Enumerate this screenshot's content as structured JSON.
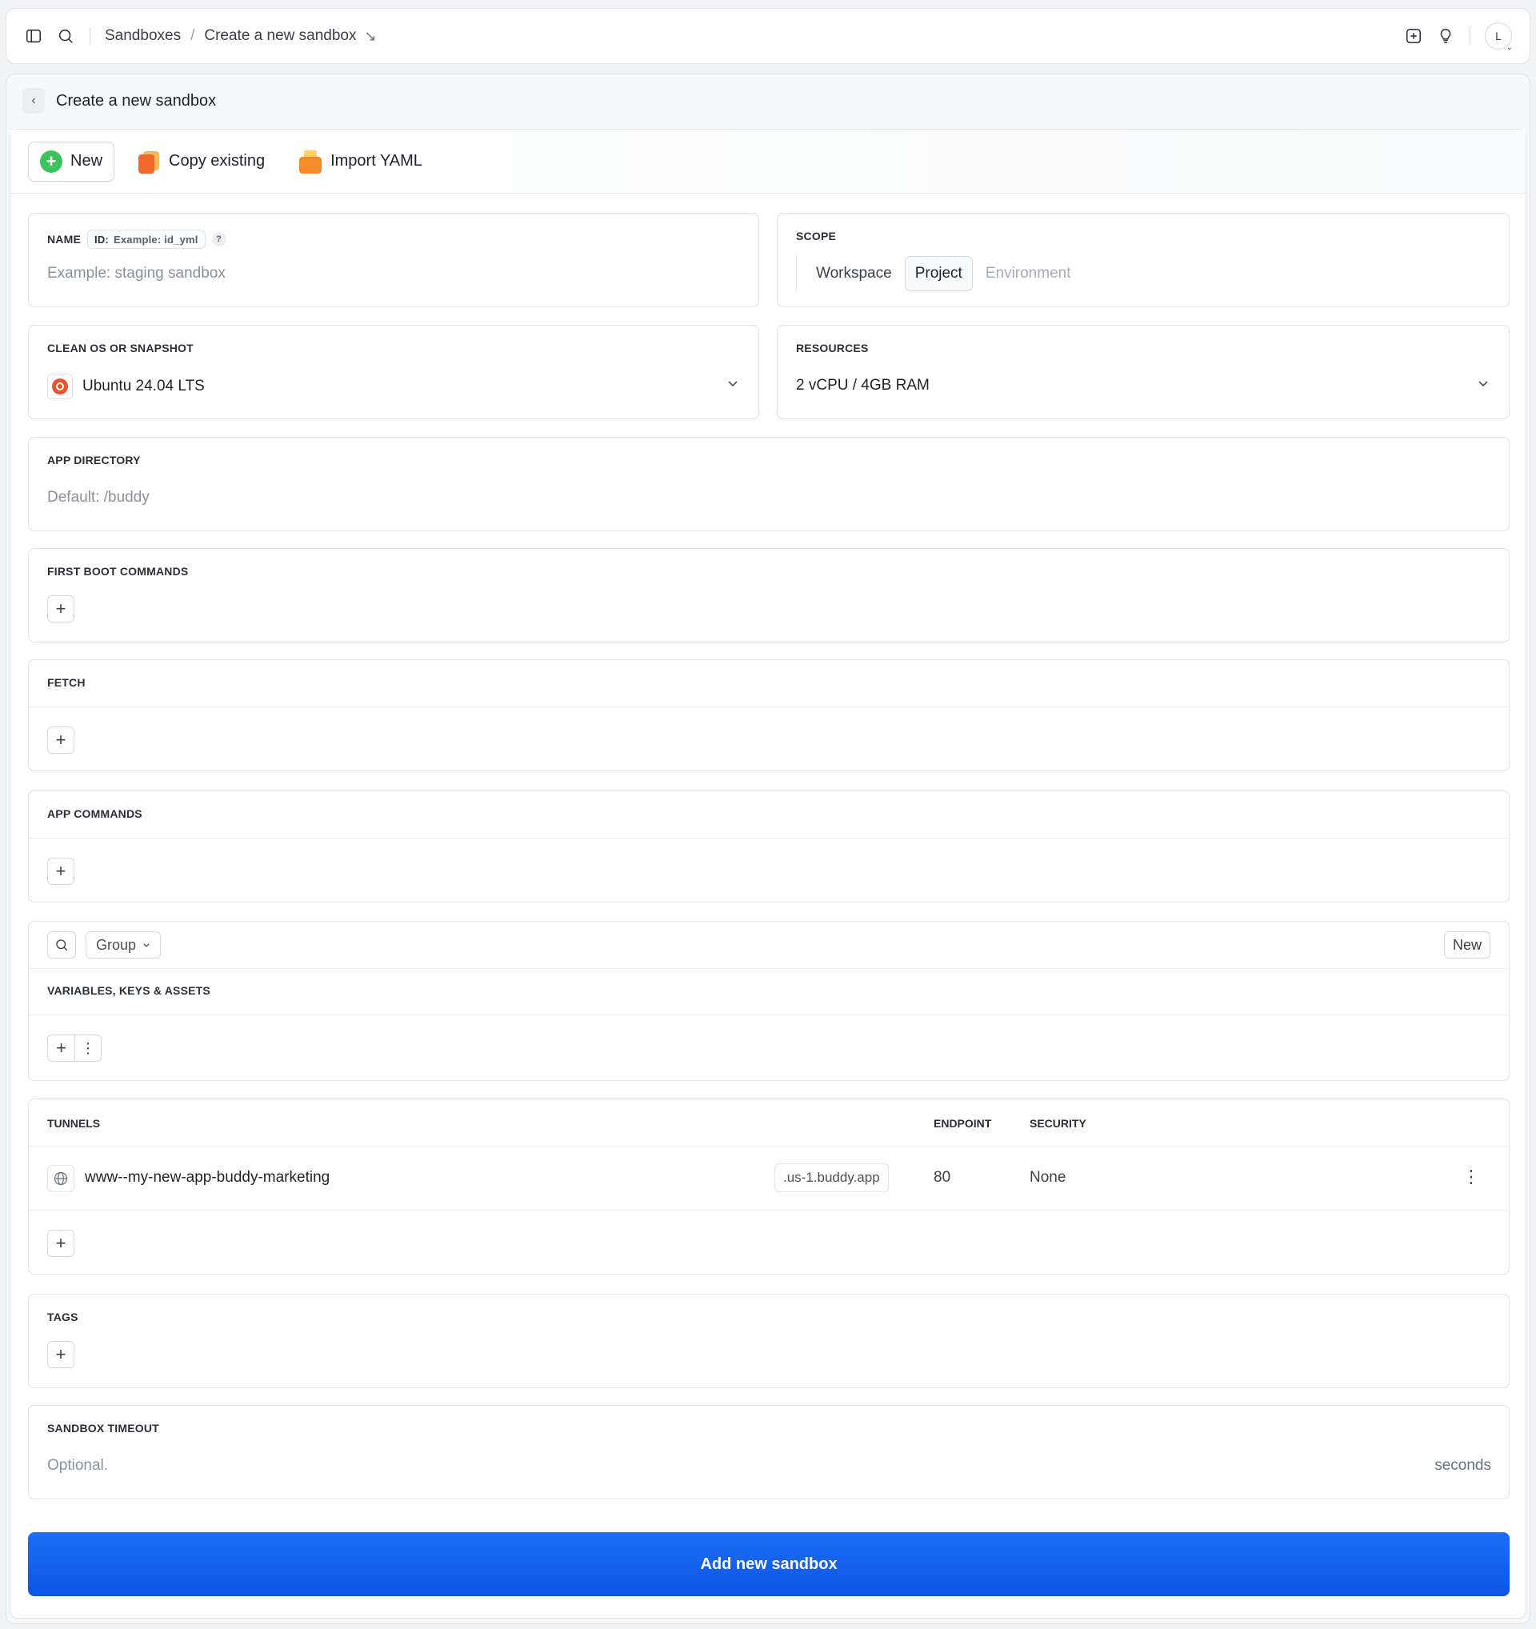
{
  "topbar": {
    "breadcrumb": [
      "Sandboxes",
      "Create a new sandbox"
    ],
    "breadcrumb_separator": "/",
    "avatar_initial": "L"
  },
  "page": {
    "title": "Create a new sandbox"
  },
  "modes": [
    {
      "label": "New",
      "active": true
    },
    {
      "label": "Copy existing",
      "active": false
    },
    {
      "label": "Import YAML",
      "active": false
    }
  ],
  "name_field": {
    "label": "NAME",
    "id_prefix": "ID:",
    "id_placeholder": "Example: id_yml",
    "help": "?",
    "placeholder": "Example: staging sandbox"
  },
  "scope": {
    "label": "SCOPE",
    "options": [
      "Workspace",
      "Project",
      "Environment"
    ],
    "selected": "Project"
  },
  "os": {
    "label": "CLEAN OS OR SNAPSHOT",
    "value": "Ubuntu 24.04 LTS"
  },
  "resources": {
    "label": "RESOURCES",
    "value": "2 vCPU / 4GB RAM"
  },
  "app_directory": {
    "label": "APP DIRECTORY",
    "placeholder": "Default: /buddy"
  },
  "first_boot": {
    "label": "FIRST BOOT COMMANDS",
    "add": "+"
  },
  "fetch": {
    "label": "FETCH",
    "add": "+"
  },
  "app_commands": {
    "label": "APP COMMANDS",
    "add": "+"
  },
  "variables": {
    "group_label": "Group",
    "new_label": "New",
    "label": "VARIABLES, KEYS & ASSETS",
    "add": "+",
    "more": "⋮"
  },
  "tunnels": {
    "headers": {
      "name": "TUNNELS",
      "endpoint": "ENDPOINT",
      "security": "SECURITY"
    },
    "rows": [
      {
        "name": "www--my-new-app-buddy-marketing",
        "domain": ".us-1.buddy.app",
        "endpoint": "80",
        "security": "None"
      }
    ],
    "add": "+"
  },
  "tags": {
    "label": "TAGS",
    "add": "+"
  },
  "timeout": {
    "label": "SANDBOX TIMEOUT",
    "placeholder": "Optional.",
    "suffix": "seconds"
  },
  "submit_label": "Add new sandbox",
  "colors": {
    "primary": "#1264f0",
    "new_icon": "#3ec35c",
    "ubuntu": "#e9542c"
  }
}
